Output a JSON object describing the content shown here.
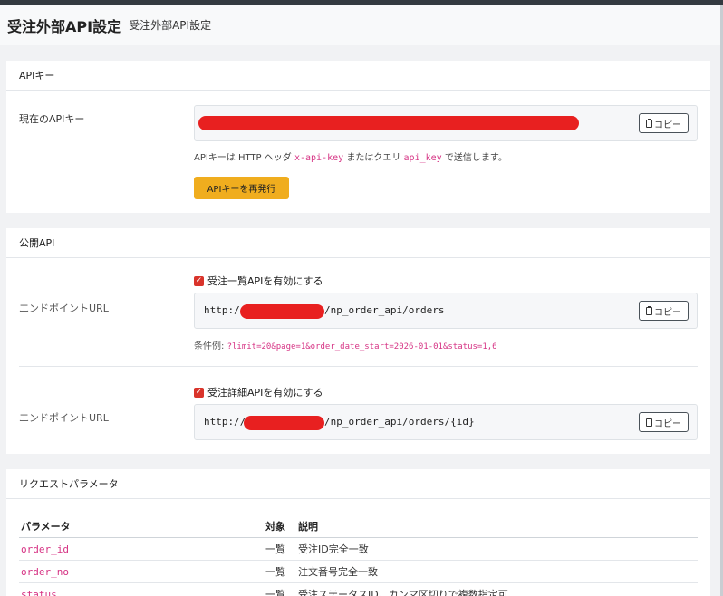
{
  "page": {
    "title": "受注外部API設定",
    "subtitle": "受注外部API設定"
  },
  "api_key_card": {
    "header": "APIキー",
    "current_key_label": "現在のAPIキー",
    "copy_label": "コピー",
    "help_prefix": "APIキーは HTTP ヘッダ",
    "help_header_name": "x-api-key",
    "help_middle": "またはクエリ",
    "help_query_name": "api_key",
    "help_suffix": "で送信します。",
    "reissue_label": "APIキーを再発行"
  },
  "public_api_card": {
    "header": "公開API",
    "list_api": {
      "checkbox_label": "受注一覧APIを有効にする",
      "endpoint_label": "エンドポイントURL",
      "url_prefix": "http:/",
      "url_suffix": "/np_order_api/orders",
      "copy_label": "コピー",
      "example_prefix": "条件例:",
      "example_query": "?limit=20&page=1&order_date_start=2026-01-01&status=1,6"
    },
    "detail_api": {
      "checkbox_label": "受注詳細APIを有効にする",
      "endpoint_label": "エンドポイントURL",
      "url_prefix": "http://",
      "url_suffix": "/np_order_api/orders/{id}",
      "copy_label": "コピー"
    }
  },
  "request_params_card": {
    "header": "リクエストパラメータ",
    "columns": [
      "パラメータ",
      "対象",
      "説明"
    ],
    "rows": [
      {
        "param": "order_id",
        "target": "一覧",
        "desc": "受注ID完全一致"
      },
      {
        "param": "order_no",
        "target": "一覧",
        "desc": "注文番号完全一致"
      },
      {
        "param": "status",
        "target": "一覧",
        "desc": "受注ステータスID、カンマ区切りで複数指定可"
      }
    ]
  },
  "colors": {
    "accent_warning": "#f0ad1e",
    "checkbox": "#d9342b",
    "code_pink": "#d63384",
    "redaction": "#e82020"
  }
}
